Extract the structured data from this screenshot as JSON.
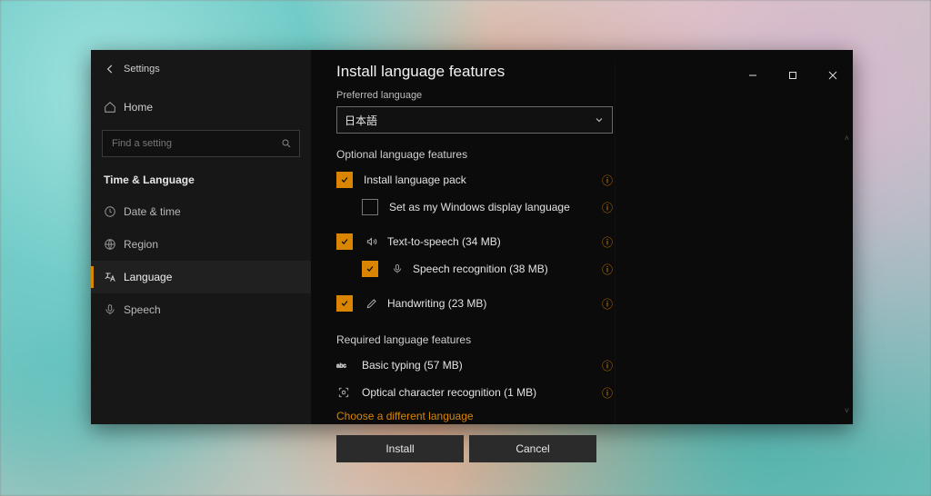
{
  "colors": {
    "accent": "#d98500"
  },
  "window": {
    "app_title": "Settings",
    "controls": {
      "min": "–",
      "max": "▢",
      "close": "✕"
    }
  },
  "sidebar": {
    "home_label": "Home",
    "search_placeholder": "Find a setting",
    "section_label": "Time & Language",
    "items": [
      {
        "id": "date-time",
        "label": "Date & time",
        "active": false
      },
      {
        "id": "region",
        "label": "Region",
        "active": false
      },
      {
        "id": "language",
        "label": "Language",
        "active": true
      },
      {
        "id": "speech",
        "label": "Speech",
        "active": false
      }
    ]
  },
  "dialog": {
    "title": "Install language features",
    "preferred_label": "Preferred language",
    "preferred_value": "日本語",
    "optional_header": "Optional language features",
    "optional": [
      {
        "id": "pack",
        "label": "Install language pack",
        "checked": true,
        "icon": null
      },
      {
        "id": "display",
        "label": "Set as my Windows display language",
        "checked": false,
        "icon": null,
        "indent": true
      },
      {
        "id": "tts",
        "label": "Text-to-speech (34 MB)",
        "checked": true,
        "icon": "tts"
      },
      {
        "id": "speechrec",
        "label": "Speech recognition (38 MB)",
        "checked": true,
        "icon": "mic",
        "indent": true
      },
      {
        "id": "handwriting",
        "label": "Handwriting (23 MB)",
        "checked": true,
        "icon": "pen"
      }
    ],
    "required_header": "Required language features",
    "required": [
      {
        "id": "typing",
        "label": "Basic typing (57 MB)",
        "icon": "abc"
      },
      {
        "id": "ocr",
        "label": "Optical character recognition (1 MB)",
        "icon": "ocr"
      }
    ],
    "choose_link": "Choose a different language",
    "install_label": "Install",
    "cancel_label": "Cancel"
  }
}
